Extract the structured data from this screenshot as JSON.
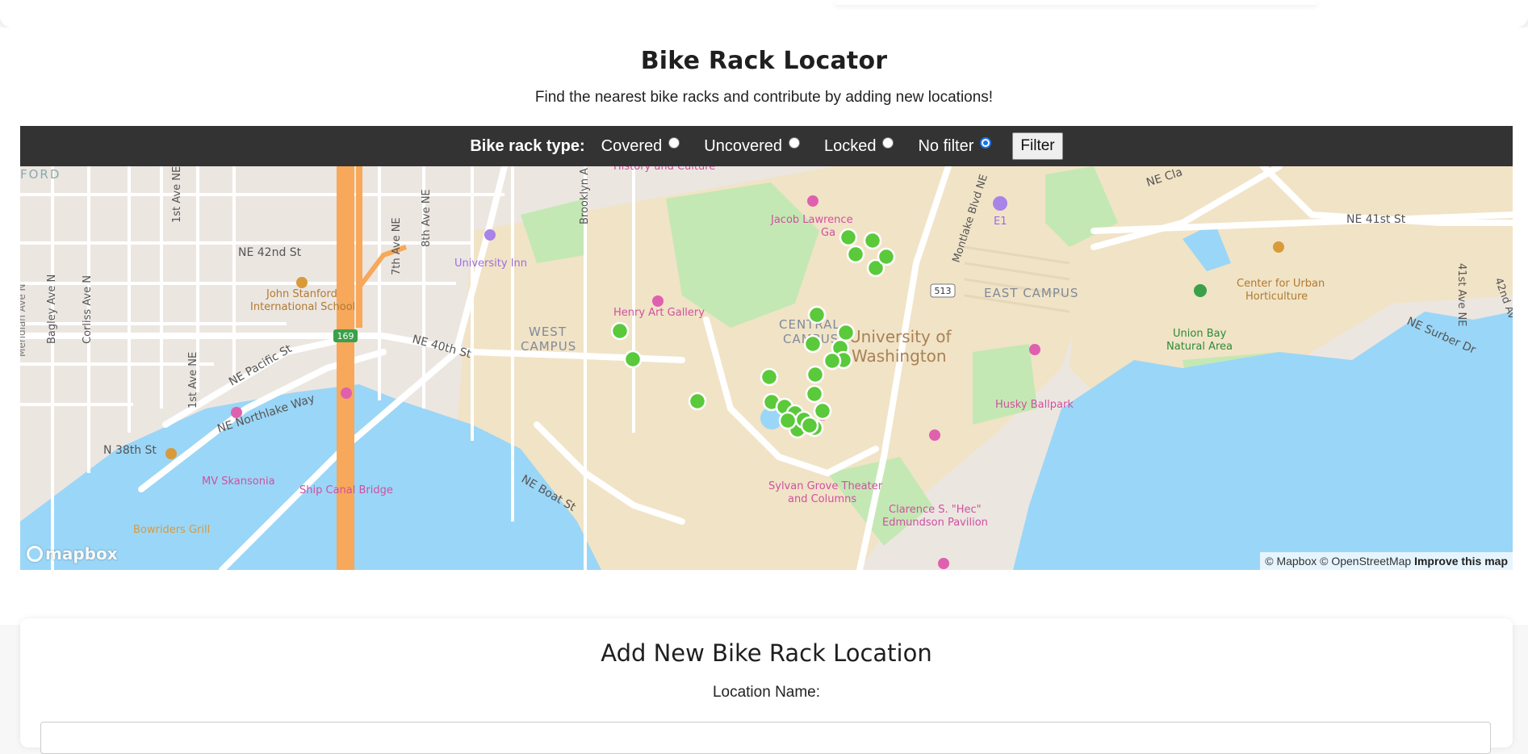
{
  "header": {
    "title": "Bike Rack Locator",
    "subtitle": "Find the nearest bike racks and contribute by adding new locations!"
  },
  "filter": {
    "label": "Bike rack type:",
    "options": [
      {
        "label": "Covered",
        "checked": false
      },
      {
        "label": "Uncovered",
        "checked": false
      },
      {
        "label": "Locked",
        "checked": false
      },
      {
        "label": "No filter",
        "checked": true
      }
    ],
    "button": "Filter"
  },
  "map": {
    "labels": {
      "ford": "FORD",
      "history": "History and Culture",
      "jacob1": "Jacob Lawrence",
      "jacob2": "Ga",
      "ne42": "NE 42nd St",
      "ne41": "NE 41st St",
      "nec": "NE Cla",
      "uinn": "University Inn",
      "jsis1": "John Stanford",
      "jsis2": "International School",
      "henry": "Henry Art Gallery",
      "west1": "WEST",
      "west2": "CAMPUS",
      "central1": "CENTRAL",
      "central2": "CAMPUS",
      "uw1": "University of",
      "uw2": "Washington",
      "east": "EAST CAMPUS",
      "e1": "E1",
      "cuh1": "Center for Urban",
      "cuh2": "Horticulture",
      "ubna1": "Union Bay",
      "ubna2": "Natural Area",
      "husky": "Husky Ballpark",
      "ne40": "NE 40th St",
      "pacific": "NE Pacific St",
      "northlake": "NE Northlake Way",
      "n38": "N 38th St",
      "boat": "NE Boat St",
      "mvsk": "MV Skansonia",
      "shipcanal": "Ship Canal Bridge",
      "bowriders": "Bowriders Grill",
      "sylvan1": "Sylvan Grove Theater",
      "sylvan2": "and Columns",
      "hec1": "Clarence S. \"Hec\"",
      "hec2": "Edmundson Pavilion",
      "bagley": "Bagley Ave N",
      "corliss": "Corliss Ave N",
      "firstaveNE": "1st Ave NE",
      "firstaveNE2": "1st Ave NE",
      "seventh": "7th Ave NE",
      "eighth": "8th Ave NE",
      "brooklyn": "Brooklyn A",
      "montlake": "Montlake Blvd NE",
      "ne41ave": "41st Ave NE",
      "ne42ave": "42nd Av",
      "surber": "NE Surber Dr",
      "sr513": "513",
      "sr169": "169",
      "meridian": "Meridian Ave N"
    },
    "rack_count": 26,
    "colors": {
      "rack": "#5ac93a",
      "water": "#9ad6f7",
      "campus": "#f1e3c6",
      "park": "#c4e8b4",
      "highway": "#f7a85a",
      "land": "#ece6e1"
    },
    "attribution": "© Mapbox © OpenStreetMap",
    "improve": "Improve this map",
    "logo": "mapbox"
  },
  "add_form": {
    "title": "Add New Bike Rack Location",
    "location_label": "Location Name:"
  }
}
